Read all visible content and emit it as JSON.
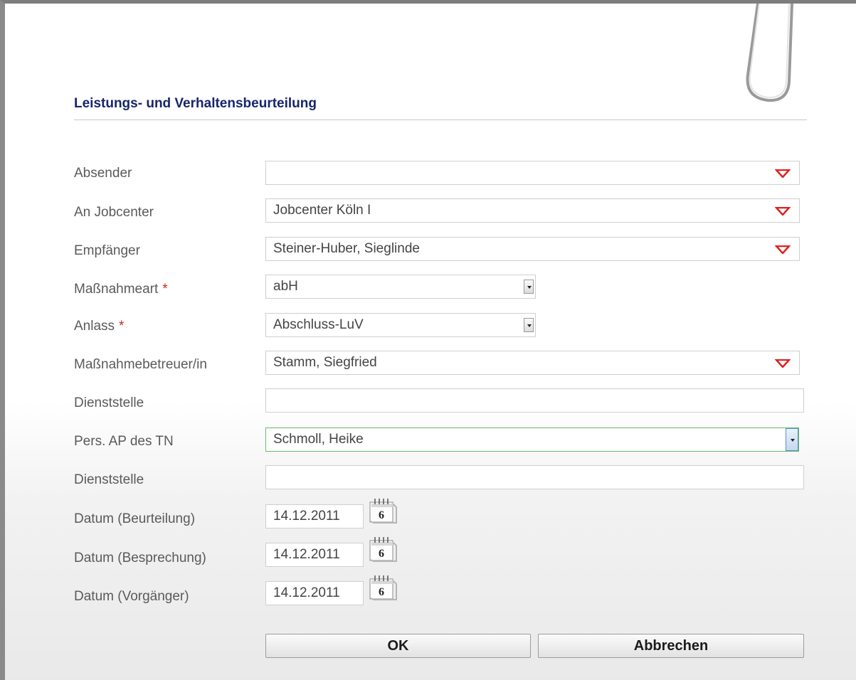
{
  "form": {
    "title": "Leistungs- und Verhaltensbeurteilung",
    "required_marker": "*",
    "fields": {
      "absender": {
        "label": "Absender",
        "value": ""
      },
      "jobcenter": {
        "label": "An Jobcenter",
        "value": "Jobcenter Köln I"
      },
      "empfaenger": {
        "label": "Empfänger",
        "value": "Steiner-Huber, Sieglinde"
      },
      "massnahmeart": {
        "label": "Maßnahmeart",
        "value": "abH"
      },
      "anlass": {
        "label": "Anlass",
        "value": "Abschluss-LuV"
      },
      "betreuer": {
        "label": "Maßnahmebetreuer/in",
        "value": "Stamm, Siegfried"
      },
      "dienststelle1": {
        "label": "Dienststelle",
        "value": ""
      },
      "pers_ap": {
        "label": "Pers. AP des TN",
        "value": "Schmoll, Heike"
      },
      "dienststelle2": {
        "label": "Dienststelle",
        "value": ""
      },
      "datum_beurteilung": {
        "label": "Datum (Beurteilung)",
        "value": "14.12.2011"
      },
      "datum_besprechung": {
        "label": "Datum (Besprechung)",
        "value": "14.12.2011"
      },
      "datum_vorgaenger": {
        "label": "Datum (Vorgänger)",
        "value": "14.12.2011"
      }
    },
    "calendar_icon": {
      "day": "6"
    },
    "buttons": {
      "ok": "OK",
      "cancel": "Abbrechen"
    }
  },
  "colors": {
    "title": "#17256b",
    "required": "#d62020",
    "dropdown_triangle": "#e02020",
    "focus_border": "#66bb66"
  }
}
